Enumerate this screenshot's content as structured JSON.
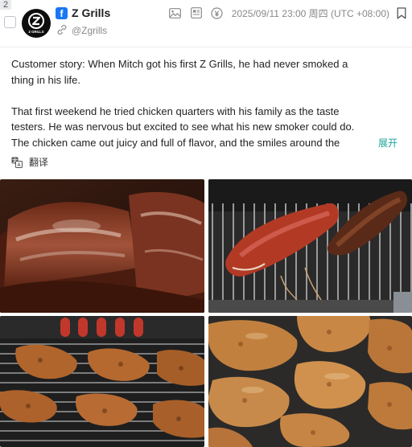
{
  "post": {
    "index": "2",
    "author": {
      "name": "Z Grills",
      "handle": "@Zgrills",
      "avatar_text": "Z GRILLS",
      "platform": "facebook"
    },
    "timestamp": "2025/09/11 23:00 周四 (UTC +08:00)",
    "text_lines": [
      "Customer story: When Mitch got his first Z Grills, he had never smoked a",
      "thing in his life.",
      "That first weekend he tried chicken quarters with his family as the taste",
      "testers. He was nervous but excited to see what his new smoker could do.",
      "The chicken came out juicy and full of flavor, and the smiles around the"
    ],
    "expand_label": "展开",
    "translate_label": "翻译",
    "photos": [
      "smoked-ribs",
      "pork-loins-on-grill",
      "chicken-quarters-on-grill",
      "smoked-chicken-quarters"
    ]
  },
  "colors": {
    "facebook_blue": "#1877f2",
    "expand_teal": "#1aa39b",
    "muted_text": "#888888"
  },
  "icons": [
    "facebook-icon",
    "link-icon",
    "image-icon",
    "article-icon",
    "copyright-icon",
    "bookmark-icon",
    "translate-icon"
  ]
}
